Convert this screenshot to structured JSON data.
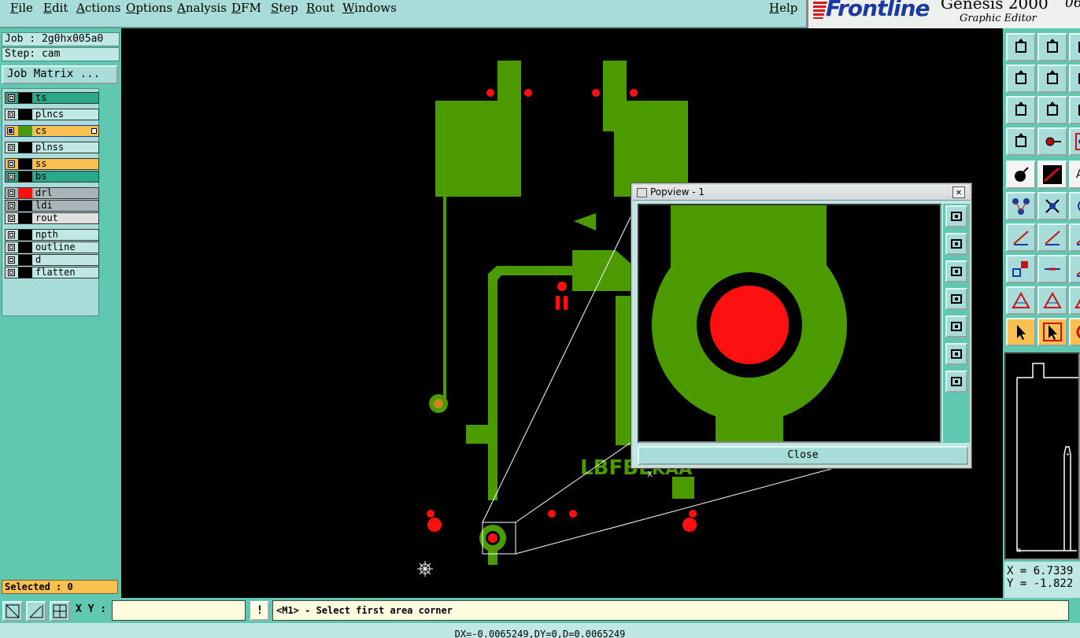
{
  "menu": [
    "File",
    "Edit",
    "Actions",
    "Options",
    "Analysis",
    "DFM",
    "Step",
    "Rout",
    "Windows"
  ],
  "help": "Help",
  "logo": {
    "brand": "Frontline",
    "product": "Genesis 2000",
    "subtitle": "Graphic Editor",
    "clock": "06:"
  },
  "job": {
    "job_line": "Job : 2g0hx005a0",
    "step_line": "Step: cam",
    "matrix_button": "Job Matrix ..."
  },
  "layers": [
    {
      "name": "ts",
      "color": "#2aa888",
      "swatch": "#000"
    },
    {
      "name": "plncs",
      "color": "#bfe8e4",
      "swatch": "#000"
    },
    {
      "name": "cs",
      "color": "#f8c050",
      "swatch": "#4a9a10",
      "active": true
    },
    {
      "name": "plnss",
      "color": "#bfe8e4",
      "swatch": "#000"
    },
    {
      "name": "ss",
      "color": "#f8c050",
      "swatch": "#000"
    },
    {
      "name": "bs",
      "color": "#2aa888",
      "swatch": "#000"
    },
    {
      "name": "drl",
      "color": "#a8b4b8",
      "swatch": "#ff1010"
    },
    {
      "name": "ldi",
      "color": "#a8b4b8",
      "swatch": "#000"
    },
    {
      "name": "rout",
      "color": "#e0e0e0",
      "swatch": "#000"
    },
    {
      "name": "npth",
      "color": "#bfe8e4",
      "swatch": "#000"
    },
    {
      "name": "outline",
      "color": "#bfe8e4",
      "swatch": "#000"
    },
    {
      "name": "d",
      "color": "#bfe8e4",
      "swatch": "#000"
    },
    {
      "name": "flatten",
      "color": "#bfe8e4",
      "swatch": "#000"
    }
  ],
  "selected": "Selected : 0",
  "canvas": {
    "silkscreen_text": "LBFBE",
    "silk_suffix": "KAA"
  },
  "popview": {
    "title": "Popview - 1",
    "close_label": "Close",
    "close_x": "✕"
  },
  "coords": {
    "x": "X = 6.7339",
    "y": "Y = -1.822"
  },
  "bottom": {
    "xy_label": "X Y :",
    "xy_value": "",
    "excl": "!",
    "prompt": "<M1> - Select first area corner"
  },
  "status": "DX=-0.0065249,DY=0,D=0.0065249",
  "colors": {
    "copper": "#4a9a00",
    "drill": "#ff1010",
    "teal": "#60c8b0"
  }
}
